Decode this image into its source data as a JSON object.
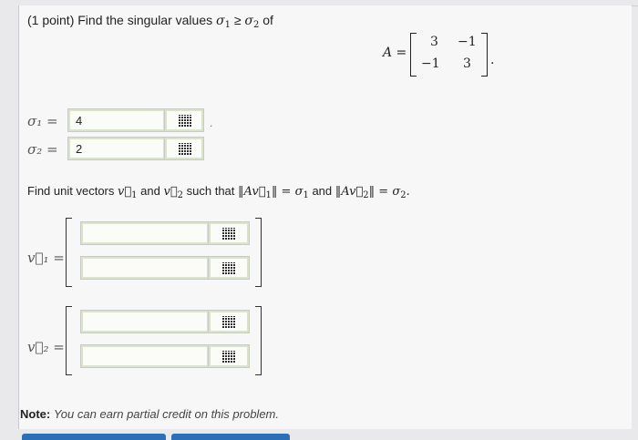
{
  "question": {
    "points": "(1 point)",
    "text": "Find the singular values",
    "sigma1": "σ",
    "ge": "≥",
    "of": "of"
  },
  "matrix": {
    "label": "A =",
    "a11": "3",
    "a12": "−1",
    "a21": "−1",
    "a22": "3",
    "period": "."
  },
  "answers": {
    "sigma1_label": "σ₁ =",
    "sigma1_value": "4",
    "sigma2_label": "σ₂ =",
    "sigma2_value": "2",
    "trailing": "."
  },
  "vectors": {
    "prompt_start": "Find unit vectors",
    "and": "and",
    "such_that": "such that",
    "v1_label": "v⃗₁ =",
    "v2_label": "v⃗₂ =",
    "v1": [
      "",
      ""
    ],
    "v2": [
      "",
      ""
    ]
  },
  "note": {
    "bold": "Note:",
    "text": "You can earn partial credit on this problem."
  }
}
